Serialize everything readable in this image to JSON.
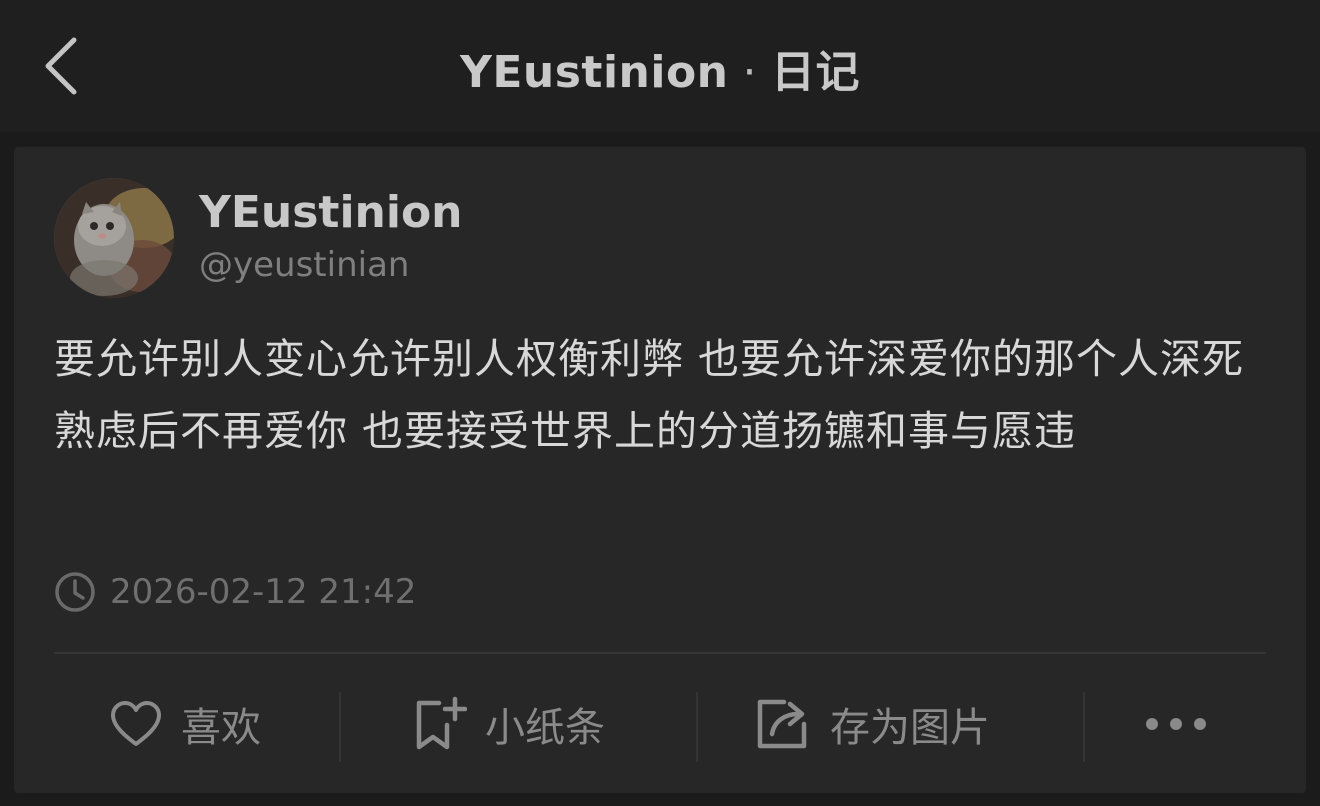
{
  "header": {
    "title": "YEustinion",
    "separator": "·",
    "subtitle": "日记"
  },
  "post": {
    "username": "YEustinion",
    "handle": "@yeustinian",
    "content": "要允许别人变心允许别人权衡利弊 也要允许深爱你的那个人深死熟虑后不再爱你 也要接受世界上的分道扬镳和事与愿违",
    "timestamp": "2026-02-12 21:42"
  },
  "actions": {
    "like_label": "喜欢",
    "note_label": "小纸条",
    "save_image_label": "存为图片",
    "more_icon": "more-dots-icon"
  },
  "colors": {
    "background": "#1b1b1b",
    "card": "#272727",
    "text_primary": "#d8d8d8",
    "text_secondary": "#7f7f7f"
  }
}
